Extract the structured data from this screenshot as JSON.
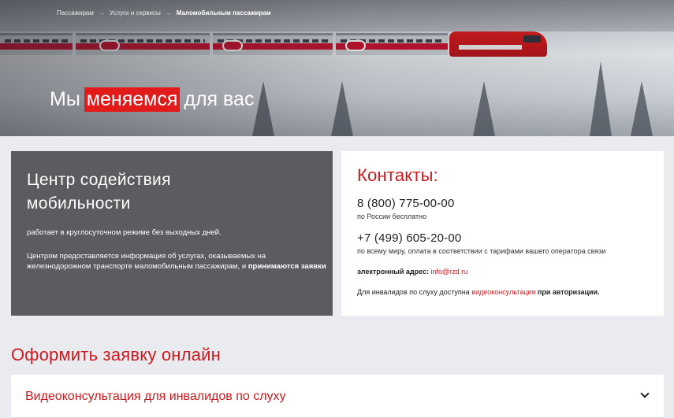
{
  "breadcrumb": {
    "items": [
      "Пассажирам",
      "Услуги и сервисы"
    ],
    "separator": "→",
    "current": "Маломобильным пассажирам"
  },
  "hero": {
    "title_before": "Мы",
    "title_highlight": "меняемся",
    "title_after": "для вас",
    "highlight_color": "#e21a1a"
  },
  "mobility_card": {
    "title": "Центр содействия мобильности",
    "paragraph1": "работает в круглосуточном режиме без выходных дней.",
    "paragraph2_text": "Центром предоставляется информация об услугах, оказываемых на железнодорожном транспорте маломобильным пассажирам, и ",
    "paragraph2_bold": "принимаются заявки",
    "background_color": "#5b5b60"
  },
  "contacts": {
    "title": "Контакты:",
    "phone1": "8 (800) 775-00-00",
    "phone1_note": "по России бесплатно",
    "phone2": "+7 (499) 605-20-00",
    "phone2_note": "по всему миру, оплата в соответствии с тарифами вашего оператора связи",
    "email_label": "электронный адрес:",
    "email": "info@rzd.ru",
    "deaf_text": "Для инвалидов по слуху доступна ",
    "deaf_link": "видеоконсультация",
    "deaf_suffix": "при авторизации.",
    "accent_color": "#d0191e"
  },
  "order": {
    "title": "Оформить заявку онлайн",
    "accordion_label": "Видеоконсультация для инвалидов по слуху",
    "accordion_icon": "chevron-down-icon"
  }
}
